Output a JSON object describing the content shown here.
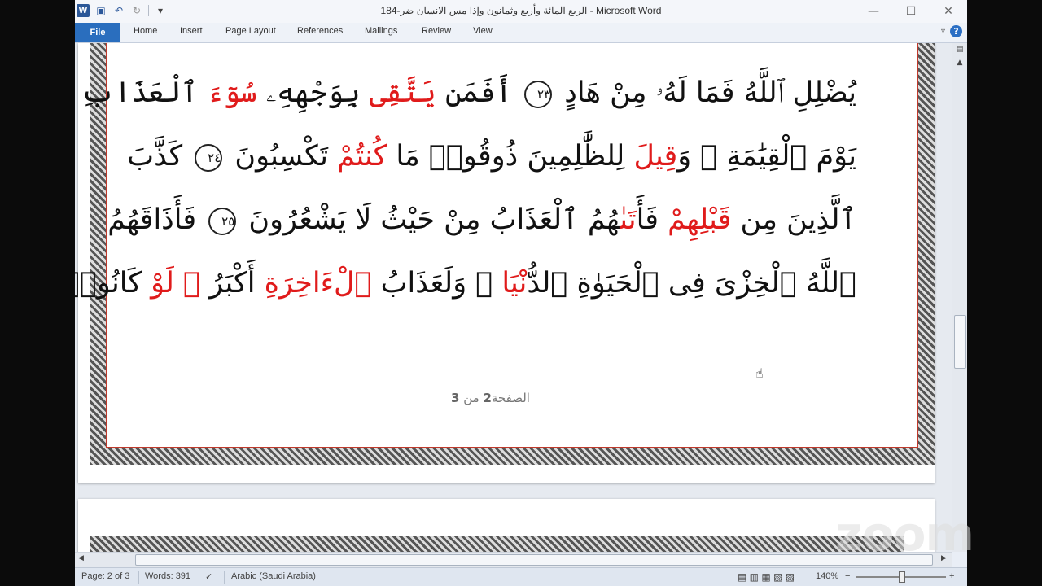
{
  "window": {
    "title": "الربع المائة وأربع وثمانون وإذا مس الانسان ضر-184  -  Microsoft Word",
    "controls": [
      "—",
      "☐",
      "✕"
    ]
  },
  "qat": {
    "word_icon": "W",
    "save_icon": "💾",
    "undo_icon": "↶",
    "redo_icon": "↻",
    "customize_icon": "▾"
  },
  "ribbon": {
    "file_label": "File",
    "tabs": [
      "Home",
      "Insert",
      "Page Layout",
      "References",
      "Mailings",
      "Review",
      "View"
    ],
    "caret": "▿",
    "help": "?"
  },
  "document": {
    "lines": [
      [
        {
          "t": "يُضْلِلِ ٱللَّهُ فَمَا لَهُۥ مِنْ هَادٍ ",
          "r": false
        },
        {
          "t": "٢٣",
          "ayah": true
        },
        {
          "t": " أَفَمَن ",
          "r": false
        },
        {
          "t": "يَتَّقِى",
          "r": true
        },
        {
          "t": " بِوَجْهِهِۦ ",
          "r": false
        },
        {
          "t": "سُوٓءَ",
          "r": true
        },
        {
          "t": " ٱلْعَذَابِ",
          "r": false
        }
      ],
      [
        {
          "t": "يَوْمَ ٱلْقِيَٰمَةِ ۚ وَ",
          "r": false
        },
        {
          "t": "قِيلَ",
          "r": true
        },
        {
          "t": " لِلظَّٰلِمِينَ ذُوقُوا۟ مَا ",
          "r": false
        },
        {
          "t": "كُنتُمْ",
          "r": true
        },
        {
          "t": " تَكْسِبُونَ ",
          "r": false
        },
        {
          "t": "٢٤",
          "ayah": true
        },
        {
          "t": " كَذَّبَ",
          "r": false
        }
      ],
      [
        {
          "t": "ٱلَّذِينَ مِن ",
          "r": false
        },
        {
          "t": "قَبْلِهِمْ",
          "r": true
        },
        {
          "t": " فَأَ",
          "r": false
        },
        {
          "t": "تَىٰ",
          "r": true
        },
        {
          "t": "هُمُ ٱلْعَذَابُ مِنْ حَيْثُ لَا يَشْعُرُونَ ",
          "r": false
        },
        {
          "t": "٢٥",
          "ayah": true
        },
        {
          "t": " فَأَذَاقَهُمُ",
          "r": false
        }
      ],
      [
        {
          "t": "ٱللَّهُ ٱلْخِزْىَ فِى ٱلْحَيَوٰةِ ٱلدُّ",
          "r": false
        },
        {
          "t": "نْيَا",
          "r": true
        },
        {
          "t": " ۖ وَلَعَذَابُ ",
          "r": false
        },
        {
          "t": "ٱلْءَاخِرَةِ",
          "r": true
        },
        {
          "t": " أَكْبَرُ",
          "r": false
        },
        {
          "t": " ۚ لَوْ",
          "r": true
        },
        {
          "t": " كَانُوا۟",
          "r": false
        }
      ]
    ],
    "page_footer_prefix": "الصفحة",
    "page_footer_current": "2",
    "page_footer_of": " من ",
    "page_footer_total": "3"
  },
  "statusbar": {
    "page": "Page: 2 of 3",
    "words": "Words: 391",
    "language": "Arabic (Saudi Arabia)",
    "zoom": "140%",
    "zoom_minus": "−",
    "zoom_plus": "+"
  },
  "watermark": "zoom"
}
